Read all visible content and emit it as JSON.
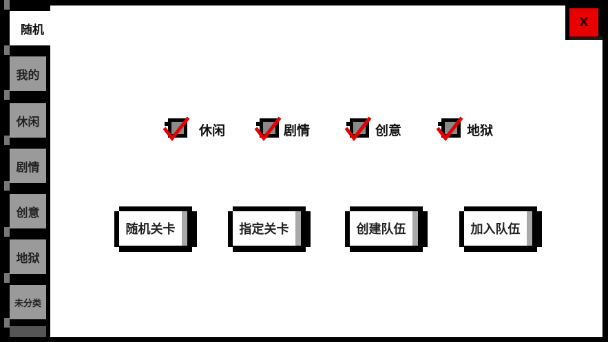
{
  "sidebar": {
    "tabs": [
      {
        "label": "随机",
        "active": true
      },
      {
        "label": "我的"
      },
      {
        "label": "休闲"
      },
      {
        "label": "剧情"
      },
      {
        "label": "创意"
      },
      {
        "label": "地狱"
      },
      {
        "label": "未分类"
      }
    ]
  },
  "close": {
    "label": "X"
  },
  "filters": [
    {
      "label": "休闲",
      "checked": true,
      "icon": "checkmark-icon"
    },
    {
      "label": "剧情",
      "checked": true,
      "icon": "checkmark-icon"
    },
    {
      "label": "创意",
      "checked": true,
      "icon": "checkmark-icon"
    },
    {
      "label": "地狱",
      "checked": true,
      "icon": "checkmark-icon"
    }
  ],
  "actions": [
    {
      "label": "随机关卡"
    },
    {
      "label": "指定关卡"
    },
    {
      "label": "创建队伍"
    },
    {
      "label": "加入队伍"
    }
  ],
  "colors": {
    "panel": "#ffffff",
    "frame": "#000000",
    "tab_inactive": "#9a9a9a",
    "close_red": "#e80000",
    "check_red": "#e60000"
  }
}
